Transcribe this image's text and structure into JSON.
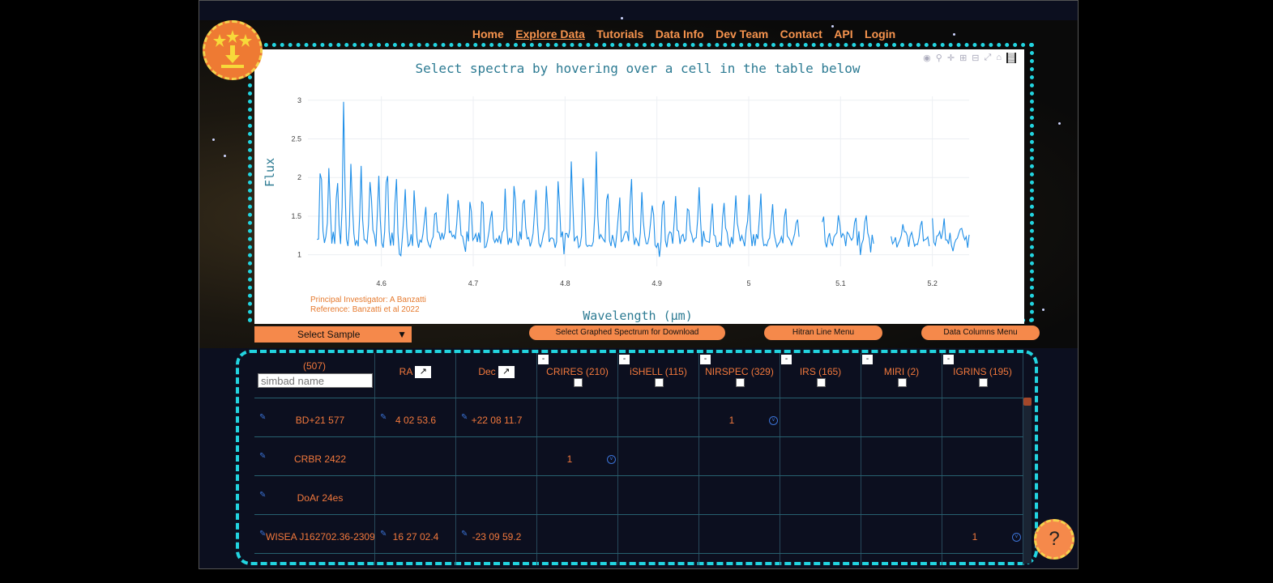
{
  "nav": {
    "items": [
      "Home",
      "Explore Data",
      "Tutorials",
      "Data Info",
      "Dev Team",
      "Contact",
      "API",
      "Login"
    ],
    "active": "Explore Data"
  },
  "plot": {
    "title": "Select spectra by hovering over a cell in the table below",
    "xlabel": "Wavelength (µm)",
    "ylabel": "Flux",
    "credit_pi": "Principal Investigator: A Banzatti",
    "credit_ref": "Reference: Banzatti et al 2022"
  },
  "chart_data": {
    "type": "line",
    "title": "Select spectra by hovering over a cell in the table below",
    "xlabel": "Wavelength (µm)",
    "ylabel": "Flux",
    "xlim": [
      4.52,
      5.24
    ],
    "ylim": [
      0.85,
      3.05
    ],
    "xticks": [
      "4.6",
      "4.7",
      "4.8",
      "4.9",
      "5",
      "5.1",
      "5.2"
    ],
    "yticks": [
      "1",
      "1.5",
      "2",
      "2.5",
      "3"
    ],
    "grid": true,
    "series": [
      {
        "color": "#1f8fe8",
        "baseline": 1.2,
        "segments": [
          [
            4.53,
            5.055
          ],
          [
            5.08,
            5.137
          ],
          [
            5.155,
            5.197
          ],
          [
            5.2,
            5.24
          ]
        ],
        "peaks": [
          [
            4.534,
            2.35
          ],
          [
            4.543,
            2.1
          ],
          [
            4.552,
            2.0
          ],
          [
            4.559,
            3.0
          ],
          [
            4.567,
            2.2
          ],
          [
            4.578,
            2.05
          ],
          [
            4.588,
            2.05
          ],
          [
            4.597,
            2.1
          ],
          [
            4.606,
            2.3
          ],
          [
            4.616,
            2.0
          ],
          [
            4.626,
            1.85
          ],
          [
            4.636,
            1.85
          ],
          [
            4.648,
            1.75
          ],
          [
            4.659,
            1.7
          ],
          [
            4.672,
            1.8
          ],
          [
            4.684,
            1.85
          ],
          [
            4.697,
            1.85
          ],
          [
            4.71,
            1.85
          ],
          [
            4.72,
            1.75
          ],
          [
            4.735,
            1.8
          ],
          [
            4.745,
            1.9
          ],
          [
            4.755,
            1.9
          ],
          [
            4.768,
            1.9
          ],
          [
            4.78,
            1.95
          ],
          [
            4.793,
            2.05
          ],
          [
            4.807,
            2.2
          ],
          [
            4.82,
            2.05
          ],
          [
            4.834,
            2.25
          ],
          [
            4.846,
            1.9
          ],
          [
            4.859,
            1.85
          ],
          [
            4.872,
            1.95
          ],
          [
            4.884,
            1.85
          ],
          [
            4.895,
            1.85
          ],
          [
            4.907,
            1.85
          ],
          [
            4.92,
            1.8
          ],
          [
            4.934,
            1.75
          ],
          [
            4.946,
            1.8
          ],
          [
            4.96,
            1.75
          ],
          [
            4.973,
            1.7
          ],
          [
            4.986,
            1.8
          ],
          [
            5.0,
            1.75
          ],
          [
            5.013,
            1.75
          ],
          [
            5.026,
            1.7
          ],
          [
            5.04,
            1.55
          ],
          [
            5.053,
            1.55
          ],
          [
            5.067,
            1.55
          ],
          [
            5.081,
            1.5
          ],
          [
            5.098,
            1.45
          ],
          [
            5.116,
            1.5
          ],
          [
            5.128,
            1.6
          ],
          [
            5.145,
            1.45
          ],
          [
            5.168,
            1.45
          ],
          [
            5.188,
            1.5
          ],
          [
            5.2,
            1.4
          ],
          [
            5.212,
            1.45
          ],
          [
            5.232,
            1.4
          ]
        ]
      }
    ]
  },
  "controls": {
    "select_sample": "Select Sample",
    "download_button": "Select Graphed Spectrum for Download",
    "hitran_button": "Hitran Line Menu",
    "columns_button": "Data Columns Menu"
  },
  "table": {
    "name_col": {
      "count": "(507)",
      "placeholder": "simbad name"
    },
    "ra_label": "RA",
    "dec_label": "Dec",
    "expand_glyph": "↗",
    "minus_glyph": "-",
    "instruments": [
      "CRIRES (210)",
      "iSHELL (115)",
      "NIRSPEC (329)",
      "IRS (165)",
      "MIRI (2)",
      "IGRINS (195)"
    ],
    "rows": [
      {
        "name": "BD+21 577",
        "ra": "4 02 53.6",
        "dec": "+22 08 11.7",
        "counts": [
          "",
          "",
          "1",
          "",
          "",
          ""
        ]
      },
      {
        "name": "CRBR 2422",
        "ra": "",
        "dec": "",
        "counts": [
          "1",
          "",
          "",
          "",
          "",
          ""
        ]
      },
      {
        "name": "DoAr 24es",
        "ra": "",
        "dec": "",
        "counts": [
          "",
          "",
          "",
          "",
          "",
          ""
        ]
      },
      {
        "name": "WISEA J162702.36-230958.7",
        "ra": "16 27 02.4",
        "dec": "-23 09 59.2",
        "counts": [
          "",
          "",
          "",
          "",
          "",
          "1"
        ]
      }
    ]
  },
  "help_glyph": "?"
}
